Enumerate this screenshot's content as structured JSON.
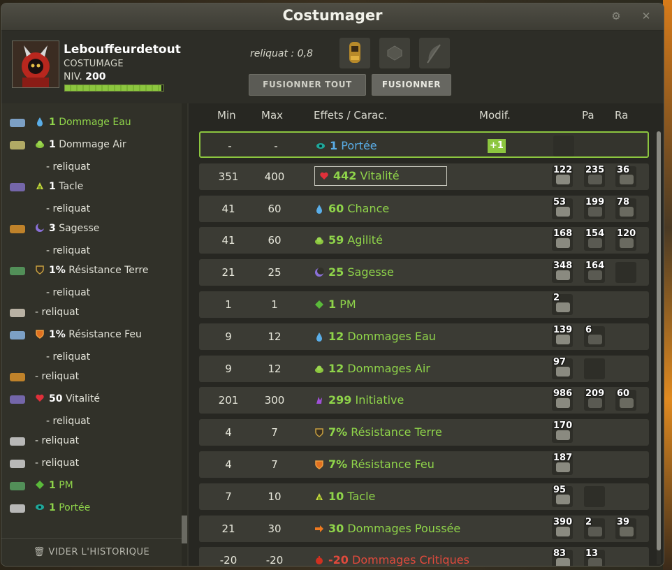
{
  "window": {
    "title": "Costumager"
  },
  "character": {
    "name": "Lebouffeurdetout",
    "subtitle": "COSTUMAGE",
    "level_label": "NIV.",
    "level": "200",
    "xp_fraction": 0.98
  },
  "reliquat_label": "reliquat : 0,8",
  "buttons": {
    "merge_all": "FUSIONNER TOUT",
    "merge": "FUSIONNER"
  },
  "history": {
    "clear_label": "VIDER L'HISTORIQUE",
    "items": [
      {
        "value": "1",
        "text": "Dommage Eau",
        "style": "green",
        "icon": "water-drop-icon"
      },
      {
        "value": "1",
        "text": "Dommage Air",
        "style": "normal",
        "icon": "air-cloud-icon"
      },
      {
        "text": "- reliquat"
      },
      {
        "value": "1",
        "text": "Tacle",
        "style": "normal",
        "icon": "tackle-icon"
      },
      {
        "text": "- reliquat"
      },
      {
        "value": "3",
        "text": "Sagesse",
        "style": "normal",
        "icon": "wisdom-moon-icon"
      },
      {
        "text": "- reliquat"
      },
      {
        "value": "1%",
        "text": "Résistance Terre",
        "style": "normal",
        "icon": "earth-shield-icon"
      },
      {
        "text": "- reliquat"
      },
      {
        "text": "- reliquat"
      },
      {
        "value": "1%",
        "text": "Résistance Feu",
        "style": "normal",
        "icon": "fire-shield-icon"
      },
      {
        "text": "- reliquat"
      },
      {
        "text": "- reliquat"
      },
      {
        "value": "50",
        "text": "Vitalité",
        "style": "normal",
        "icon": "heart-icon"
      },
      {
        "text": "- reliquat"
      },
      {
        "text": "- reliquat"
      },
      {
        "text": "- reliquat"
      },
      {
        "value": "1",
        "text": "PM",
        "style": "green",
        "icon": "pm-diamond-icon"
      },
      {
        "value": "1",
        "text": "Portée",
        "style": "green",
        "icon": "range-eye-icon"
      }
    ]
  },
  "table": {
    "headers": {
      "min": "Min",
      "max": "Max",
      "effects": "Effets / Carac.",
      "modif": "Modif.",
      "pa": "Pa",
      "ra": "Ra"
    },
    "rows": [
      {
        "min": "-",
        "max": "-",
        "value": "1",
        "label": "Portée",
        "color": "blue",
        "icon": "range-eye-icon",
        "modif": "+1",
        "runes": [
          ""
        ]
      },
      {
        "min": "351",
        "max": "400",
        "value": "442",
        "label": "Vitalité",
        "color": "green",
        "icon": "heart-icon",
        "boxed": true,
        "runes": [
          "122",
          "235",
          "36"
        ]
      },
      {
        "min": "41",
        "max": "60",
        "value": "60",
        "label": "Chance",
        "color": "green",
        "icon": "water-drop-icon",
        "runes": [
          "53",
          "199",
          "78"
        ]
      },
      {
        "min": "41",
        "max": "60",
        "value": "59",
        "label": "Agilité",
        "color": "green",
        "icon": "air-cloud-icon",
        "runes": [
          "168",
          "154",
          "120"
        ]
      },
      {
        "min": "21",
        "max": "25",
        "value": "25",
        "label": "Sagesse",
        "color": "green",
        "icon": "wisdom-moon-icon",
        "runes": [
          "348",
          "164",
          ""
        ]
      },
      {
        "min": "1",
        "max": "1",
        "value": "1",
        "label": "PM",
        "color": "green",
        "icon": "pm-diamond-icon",
        "runes": [
          "2"
        ]
      },
      {
        "min": "9",
        "max": "12",
        "value": "12",
        "label": "Dommages Eau",
        "color": "green",
        "icon": "water-drop-icon",
        "runes": [
          "139",
          "6"
        ]
      },
      {
        "min": "9",
        "max": "12",
        "value": "12",
        "label": "Dommages Air",
        "color": "green",
        "icon": "air-cloud-icon",
        "runes": [
          "97",
          ""
        ]
      },
      {
        "min": "201",
        "max": "300",
        "value": "299",
        "label": "Initiative",
        "color": "green",
        "icon": "initiative-icon",
        "runes": [
          "986",
          "209",
          "60"
        ]
      },
      {
        "min": "4",
        "max": "7",
        "value": "7%",
        "label": "Résistance Terre",
        "color": "green",
        "icon": "earth-shield-icon",
        "runes": [
          "170"
        ]
      },
      {
        "min": "4",
        "max": "7",
        "value": "7%",
        "label": "Résistance Feu",
        "color": "green",
        "icon": "fire-shield-icon",
        "runes": [
          "187"
        ]
      },
      {
        "min": "7",
        "max": "10",
        "value": "10",
        "label": "Tacle",
        "color": "green",
        "icon": "tackle-icon",
        "runes": [
          "95",
          ""
        ]
      },
      {
        "min": "21",
        "max": "30",
        "value": "30",
        "label": "Dommages Poussée",
        "color": "green",
        "icon": "push-arrow-icon",
        "runes": [
          "390",
          "2",
          "39"
        ]
      },
      {
        "min": "-20",
        "max": "-20",
        "value": "-20",
        "label": "Dommages Critiques",
        "color": "red",
        "icon": "crit-icon",
        "runes": [
          "83",
          "13"
        ]
      }
    ]
  },
  "colors": {
    "accent": "#8cc63f",
    "blue": "#5aaee8",
    "red": "#e04a3c"
  }
}
